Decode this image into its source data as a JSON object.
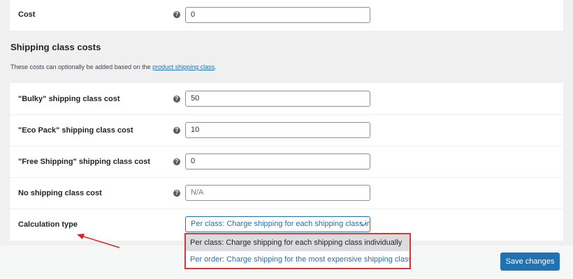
{
  "cost_row": {
    "label": "Cost",
    "value": "0"
  },
  "section": {
    "title": "Shipping class costs",
    "description": "These costs can optionally be added based on the ",
    "link_text": "product shipping class",
    "description_end": "."
  },
  "class_rows": [
    {
      "label": "\"Bulky\" shipping class cost",
      "value": "50"
    },
    {
      "label": "\"Eco Pack\" shipping class cost",
      "value": "10"
    },
    {
      "label": "\"Free Shipping\" shipping class cost",
      "value": "0"
    },
    {
      "label": "No shipping class cost",
      "placeholder": "N/A"
    }
  ],
  "calculation": {
    "label": "Calculation type",
    "selected": "Per class: Charge shipping for each shipping class individually",
    "options": [
      "Per class: Charge shipping for each shipping class individually",
      "Per order: Charge shipping for the most expensive shipping class"
    ]
  },
  "help_icon_glyph": "?",
  "save_label": "Save changes",
  "colors": {
    "accent": "#2271b1",
    "highlight_border": "#d63638",
    "annotation_arrow": "#e02020",
    "selected_option_bg": "#dcdcde"
  }
}
